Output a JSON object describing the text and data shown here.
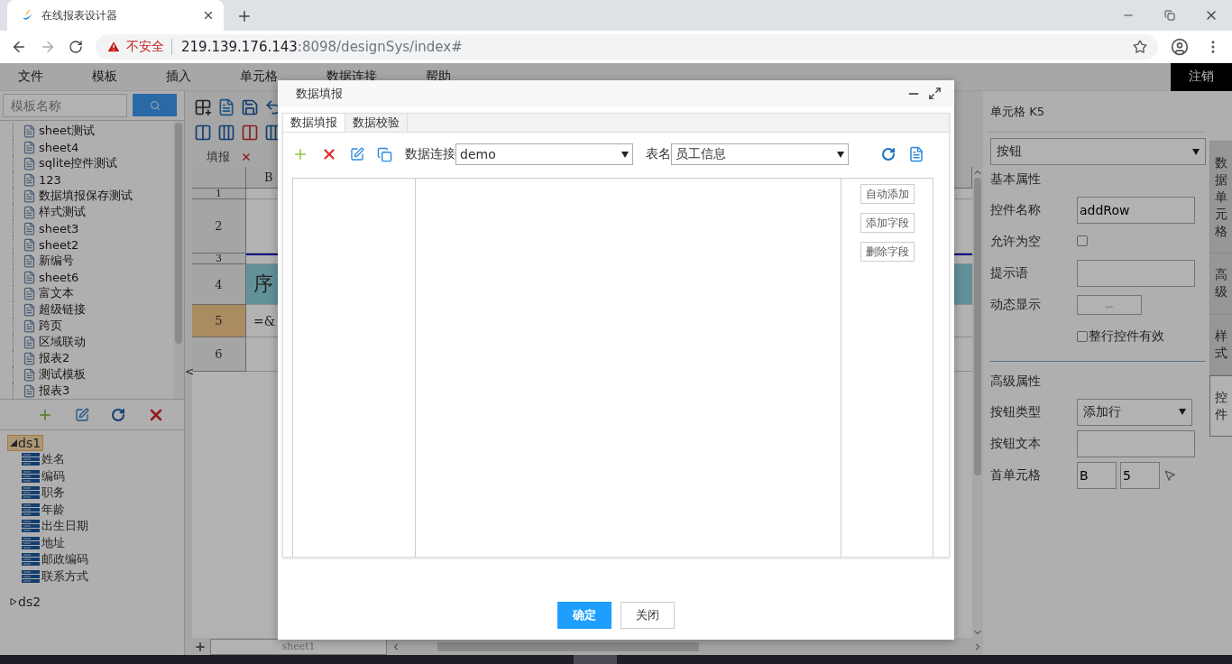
{
  "browser": {
    "tab_title": "在线报表设计器",
    "security_label": "不安全",
    "url_host": "219.139.176.143",
    "url_path": ":8098/designSys/index#"
  },
  "menu": {
    "items": [
      "文件",
      "模板",
      "插入",
      "单元格",
      "数据连接",
      "帮助"
    ],
    "logout": "注销"
  },
  "left_panel": {
    "search": {
      "placeholder": "模板名称"
    },
    "templates": [
      "sheet测试",
      "sheet4",
      "sqlite控件测试",
      "123",
      "数据填报保存测试",
      "样式测试",
      "sheet3",
      "sheet2",
      "新编号",
      "sheet6",
      "富文本",
      "超级链接",
      "跨页",
      "区域联动",
      "报表2",
      "测试模板",
      "报表3"
    ],
    "datasets": [
      {
        "name": "ds1",
        "expanded": true,
        "selected": true,
        "children": [
          {
            "name": "姓名"
          },
          {
            "name": "编码"
          },
          {
            "name": "职务"
          },
          {
            "name": "年龄"
          },
          {
            "name": "出生日期"
          },
          {
            "name": "地址"
          },
          {
            "name": "邮政编码"
          },
          {
            "name": "联系方式"
          }
        ]
      },
      {
        "name": "ds2",
        "expanded": false,
        "selected": false
      }
    ]
  },
  "sheet": {
    "tab": "填报",
    "column_header": "B",
    "collapse_handle": "<",
    "rows": [
      {
        "number": "1",
        "selected": false
      },
      {
        "number": "2",
        "selected": false
      },
      {
        "number": "3",
        "selected": false
      },
      {
        "number": "4",
        "selected": false,
        "cell": "序",
        "kind": "header"
      },
      {
        "number": "5",
        "selected": true,
        "cell": "=&",
        "kind": "formula"
      },
      {
        "number": "6",
        "selected": false
      }
    ],
    "sheet_tabs": [
      {
        "label": "sheet1",
        "selected": true
      }
    ]
  },
  "right_panel": {
    "title": "单元格 K5",
    "widget_type": "按钮",
    "basic_section": "基本属性",
    "fields": [
      {
        "kind": "text",
        "label": "控件名称",
        "value": "addRow"
      },
      {
        "kind": "checkbox",
        "label": "允许为空",
        "checked": false
      },
      {
        "kind": "text",
        "label": "提示语"
      },
      {
        "kind": "button",
        "label": "动态显示",
        "button": "..."
      },
      {
        "kind": "option",
        "label": "整行控件有效",
        "checked": false
      }
    ],
    "advanced_section": "高级属性",
    "advanced_fields": [
      {
        "kind": "select",
        "label": "按钮类型",
        "value": "添加行"
      },
      {
        "kind": "text",
        "label": "按钮文本"
      },
      {
        "kind": "cell_ref",
        "label": "首单元格",
        "column": "B",
        "row": "5"
      }
    ],
    "side_tabs": [
      {
        "label": "数据单元格",
        "selected": false
      },
      {
        "label": "高级",
        "selected": false
      },
      {
        "label": "样式",
        "selected": false
      },
      {
        "label": "控件",
        "selected": true
      }
    ]
  },
  "dialog": {
    "title": "数据填报",
    "tabs": [
      {
        "label": "数据填报",
        "selected": true
      },
      {
        "label": "数据校验",
        "selected": false
      }
    ],
    "connection_label": "数据连接",
    "connection": "demo",
    "table_label": "表名",
    "table": "员工信息",
    "field_buttons": [
      "自动添加",
      "添加字段",
      "删除字段"
    ],
    "confirm": "确定",
    "close": "关闭"
  }
}
